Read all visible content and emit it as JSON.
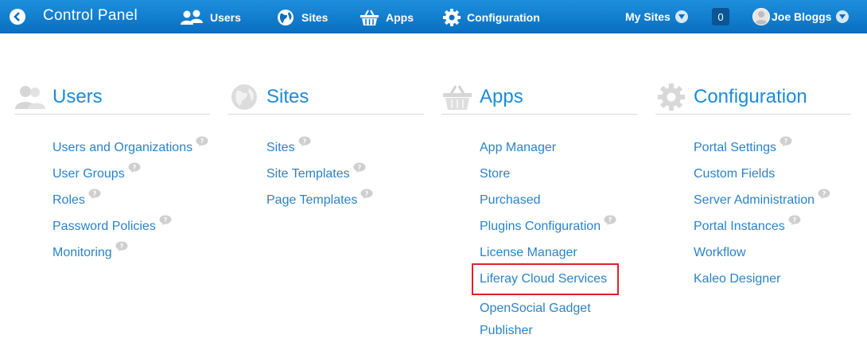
{
  "topbar": {
    "title": "Control Panel",
    "nav": [
      {
        "label": "Users",
        "icon": "users-icon"
      },
      {
        "label": "Sites",
        "icon": "globe-icon"
      },
      {
        "label": "Apps",
        "icon": "basket-icon"
      },
      {
        "label": "Configuration",
        "icon": "gear-icon"
      }
    ],
    "my_sites_label": "My Sites",
    "notification_count": "0",
    "user_name": "Joe Bloggs"
  },
  "sections": {
    "users": {
      "title": "Users",
      "links": [
        "Users and Organizations",
        "User Groups",
        "Roles",
        "Password Policies",
        "Monitoring"
      ]
    },
    "sites": {
      "title": "Sites",
      "links": [
        "Sites",
        "Site Templates",
        "Page Templates"
      ]
    },
    "apps": {
      "title": "Apps",
      "links": [
        "App Manager",
        "Store",
        "Purchased",
        "Plugins Configuration",
        "License Manager",
        "Liferay Cloud Services",
        "OpenSocial Gadget",
        "Publisher"
      ]
    },
    "configuration": {
      "title": "Configuration",
      "links": [
        "Portal Settings",
        "Custom Fields",
        "Server Administration",
        "Portal Instances",
        "Workflow",
        "Kaleo Designer"
      ]
    }
  },
  "colors": {
    "topbar": "#0a6fc2",
    "link": "#2a82c8",
    "heading": "#1a8bdc",
    "highlight": "#e0202a"
  }
}
